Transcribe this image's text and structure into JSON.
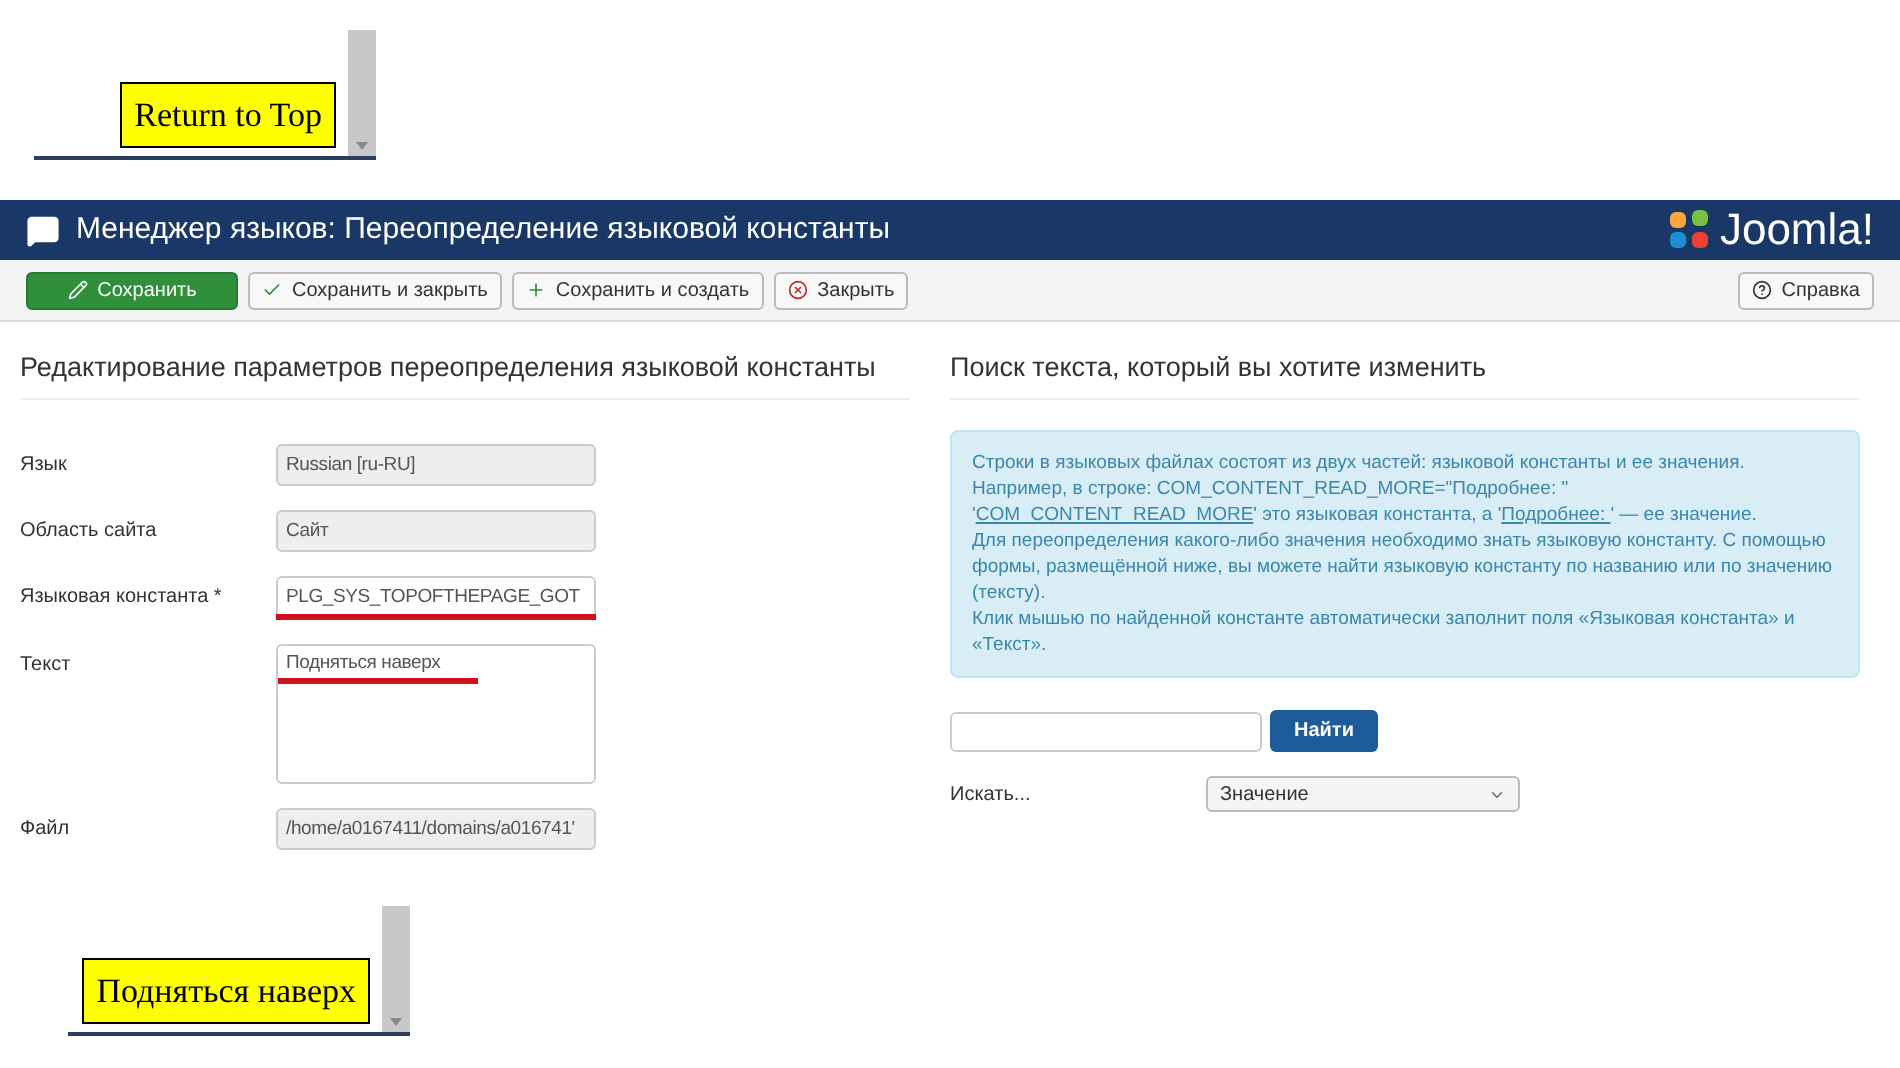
{
  "snippet_top": {
    "button": "Return to Top"
  },
  "header": {
    "title": "Менеджер языков: Переопределение языковой константы",
    "logo": "Joomla!"
  },
  "toolbar": [
    {
      "kind": "primary",
      "label": "Сохранить"
    },
    {
      "kind": "default",
      "label": "Сохранить и закрыть"
    },
    {
      "kind": "default",
      "label": "Сохранить и создать"
    },
    {
      "kind": "default",
      "label": "Закрыть"
    }
  ],
  "help_button": {
    "label": "Справка"
  },
  "edit_panel": {
    "title": "Редактирование параметров переопределения языковой константы",
    "fields": [
      {
        "label": "Язык",
        "kind": "readonly",
        "value": "Russian [ru-RU]",
        "marked": false
      },
      {
        "label": "Область сайта",
        "kind": "readonly",
        "value": "Сайт",
        "marked": false
      },
      {
        "label": "Языковая константа *",
        "kind": "input",
        "value": "PLG_SYS_TOPOFTHEPAGE_GOT",
        "marked": true
      },
      {
        "label": "Текст",
        "kind": "textarea",
        "value": "Подняться наверх",
        "marked": true
      },
      {
        "label": "Файл",
        "kind": "readonly",
        "value": "/home/a0167411/domains/a016741'",
        "marked": false
      }
    ]
  },
  "search_panel": {
    "title": "Поиск текста, который вы хотите изменить",
    "info": [
      [
        {
          "text": "Строки в языковых файлах состоят из двух частей: языковой константы и ее значения.",
          "underlined": false
        }
      ],
      [
        {
          "text": "Например, в строке: COM_CONTENT_READ_MORE=\"Подробнее: \"",
          "underlined": false
        }
      ],
      [
        {
          "text": "'",
          "underlined": false
        },
        {
          "text": "COM_CONTENT_READ_MORE",
          "underlined": true
        },
        {
          "text": "' это языковая константа, а '",
          "underlined": false
        },
        {
          "text": "Подробнее: ",
          "underlined": true
        },
        {
          "text": "' — ее значение.",
          "underlined": false
        }
      ],
      [
        {
          "text": "Для переопределения какого-либо значения необходимо знать языковую константу. С помощью формы, размещённой ниже, вы можете найти языковую константу по названию или по значению (тексту).",
          "underlined": false
        }
      ],
      [
        {
          "text": "Клик мышью по найденной константе автоматически заполнит поля «Языковая константа» и «Текст».",
          "underlined": false
        }
      ]
    ],
    "search_button": "Найти",
    "search_in_label": "Искать...",
    "search_in_value": "Значение"
  },
  "snippet_bottom": {
    "button": "Подняться наверх"
  }
}
